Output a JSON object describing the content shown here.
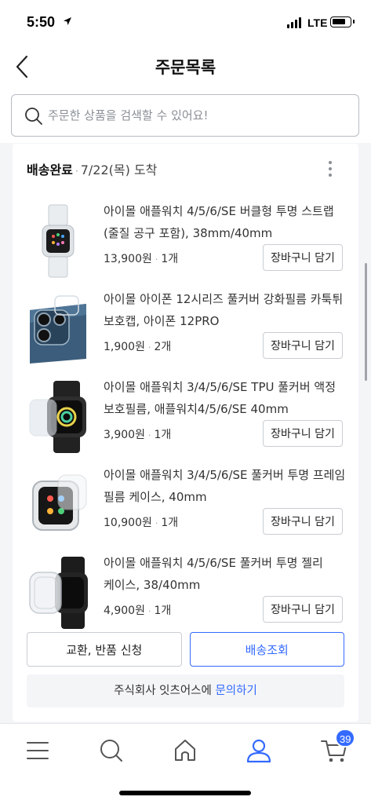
{
  "status_bar": {
    "time": "5:50",
    "network": "LTE"
  },
  "header": {
    "title": "주문목록"
  },
  "search": {
    "placeholder": "주문한 상품을 검색할 수 있어요!"
  },
  "order": {
    "status": "배송완료",
    "date": "7/22(목) 도착",
    "items": [
      {
        "name": "아이몰 애플워치 4/5/6/SE 버클형 투명 스트랩 (줄질 공구 포함), 38mm/40mm",
        "price": "13,900원",
        "qty": "1개",
        "button": "장바구니 담기"
      },
      {
        "name": "아이몰 아이폰 12시리즈 풀커버 강화필름 카툭튀 보호캡, 아이폰 12PRO",
        "price": "1,900원",
        "qty": "2개",
        "button": "장바구니 담기"
      },
      {
        "name": "아이몰 애플워치 3/4/5/6/SE TPU 풀커버 액정 보호필름, 애플워치4/5/6/SE 40mm",
        "price": "3,900원",
        "qty": "1개",
        "button": "장바구니 담기"
      },
      {
        "name": "아이몰 애플워치 3/4/5/6/SE 풀커버 투명 프레임 필름 케이스, 40mm",
        "price": "10,900원",
        "qty": "1개",
        "button": "장바구니 담기"
      },
      {
        "name": "아이몰 애플워치 4/5/6/SE 풀커버 투명 젤리 케이스, 38/40mm",
        "price": "4,900원",
        "qty": "1개",
        "button": "장바구니 담기"
      }
    ],
    "exchange_label": "교환, 반품 신청",
    "track_label": "배송조회",
    "inquiry_text": "주식회사 잇츠어스에",
    "inquiry_link": "문의하기"
  },
  "bottom_nav": {
    "items": [
      "menu-icon",
      "search-icon",
      "home-icon",
      "user-icon",
      "cart-icon"
    ],
    "cart_count": "39"
  },
  "colors": {
    "accent": "#346aff",
    "background": "#f4f5f7",
    "border": "#c9cdd2"
  }
}
